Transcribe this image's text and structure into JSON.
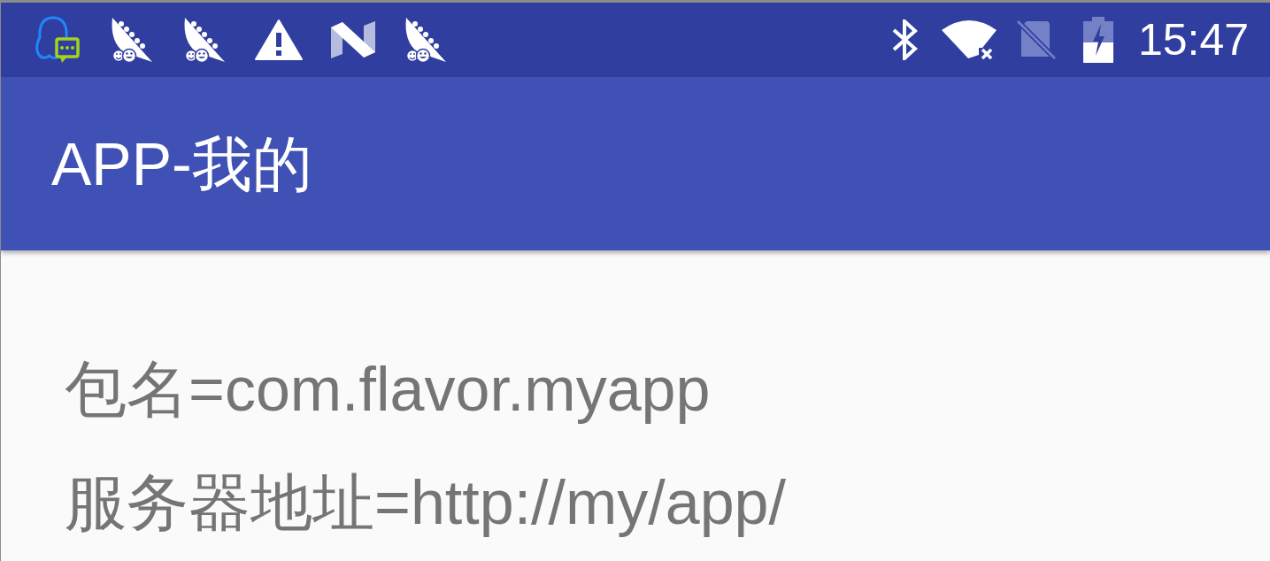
{
  "status_bar": {
    "time": "15:47"
  },
  "app_bar": {
    "title": "APP-我的"
  },
  "content": {
    "lines": [
      "包名=com.flavor.myapp",
      "服务器地址=http://my/app/"
    ]
  }
}
